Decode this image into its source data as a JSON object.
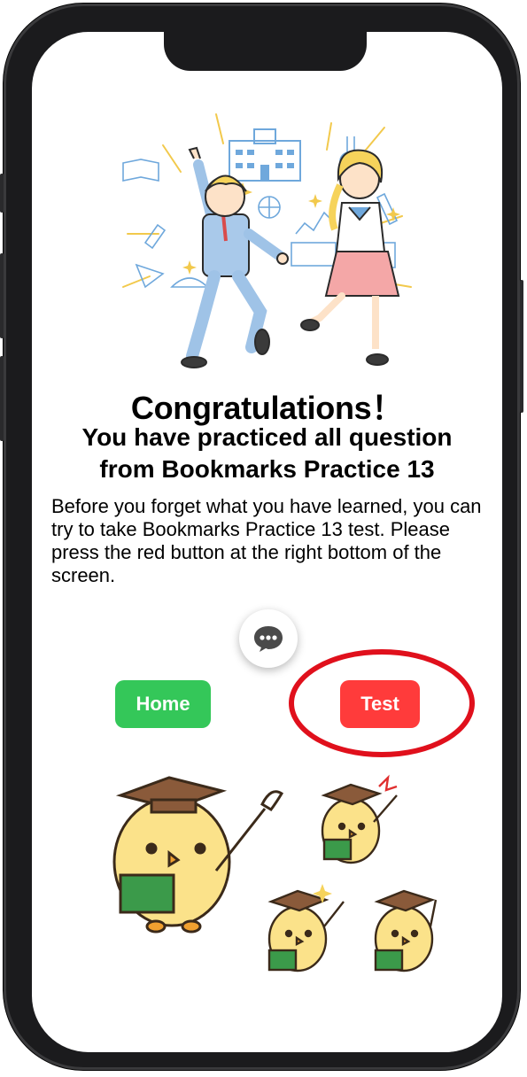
{
  "screen": {
    "title": "Congratulations！",
    "subtitle": "You have practiced all question from Bookmarks Practice 13",
    "body": "Before you forget what you have learned, you can try to take Bookmarks Practice 13 test. Please press the red button at the right bottom of the screen."
  },
  "actions": {
    "home_label": "Home",
    "test_label": "Test"
  },
  "icons": {
    "chat": "chat-bubble-icon"
  },
  "colors": {
    "home_button": "#34c759",
    "test_button": "#ff3b3b",
    "highlight_ring": "#e0101c"
  }
}
